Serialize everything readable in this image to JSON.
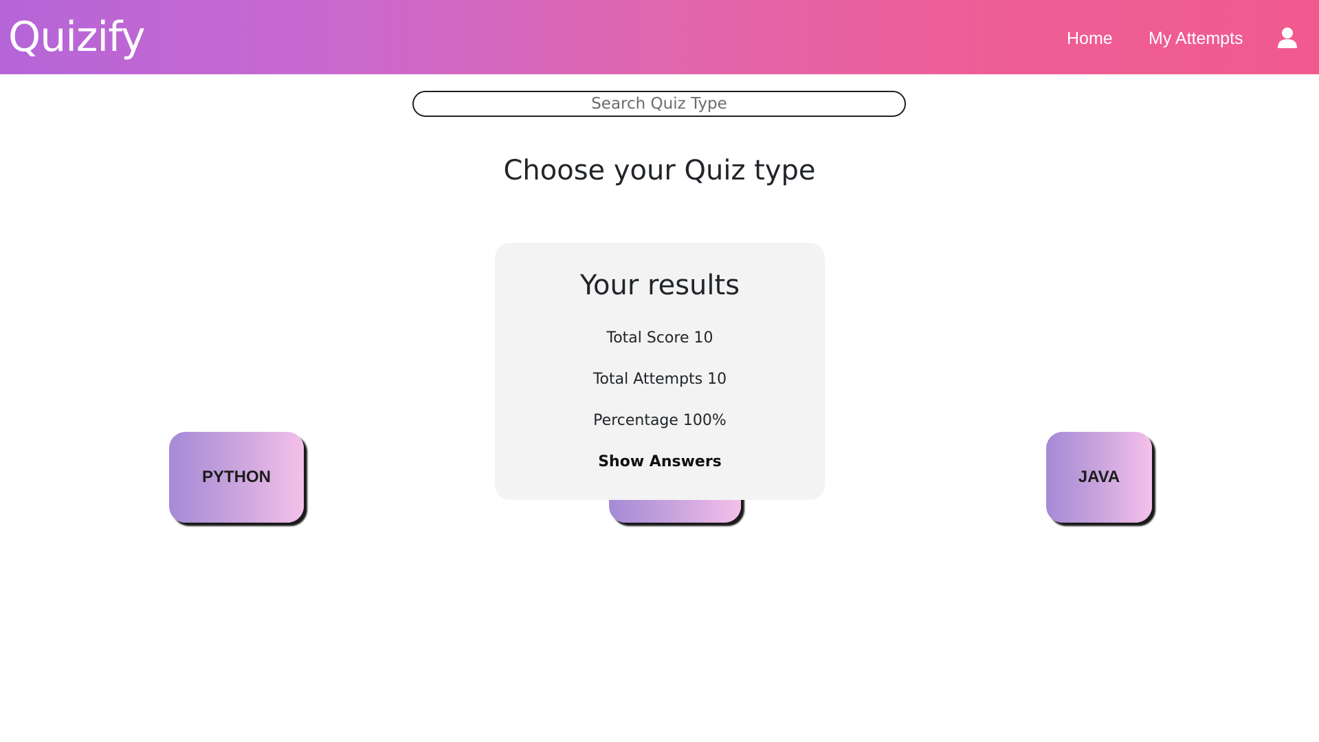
{
  "header": {
    "logo": "Quizify",
    "nav": {
      "home": "Home",
      "attempts": "My Attempts"
    },
    "user_icon": "user-icon"
  },
  "search": {
    "placeholder": "Search Quiz Type",
    "value": ""
  },
  "main": {
    "title": "Choose your Quiz type",
    "quiz_types": [
      "PYTHON",
      "",
      "JAVA"
    ]
  },
  "results": {
    "title": "Your results",
    "total_score": "Total Score 10",
    "total_attempts": "Total Attempts 10",
    "percentage": "Percentage 100%",
    "show_answers": "Show Answers"
  },
  "colors": {
    "header_gradient_start": "#b565d8",
    "header_gradient_end": "#f05a8e",
    "card_gradient_start": "#a58ad6",
    "card_gradient_end": "#f5c0ea",
    "results_background": "#f3f3f3"
  }
}
